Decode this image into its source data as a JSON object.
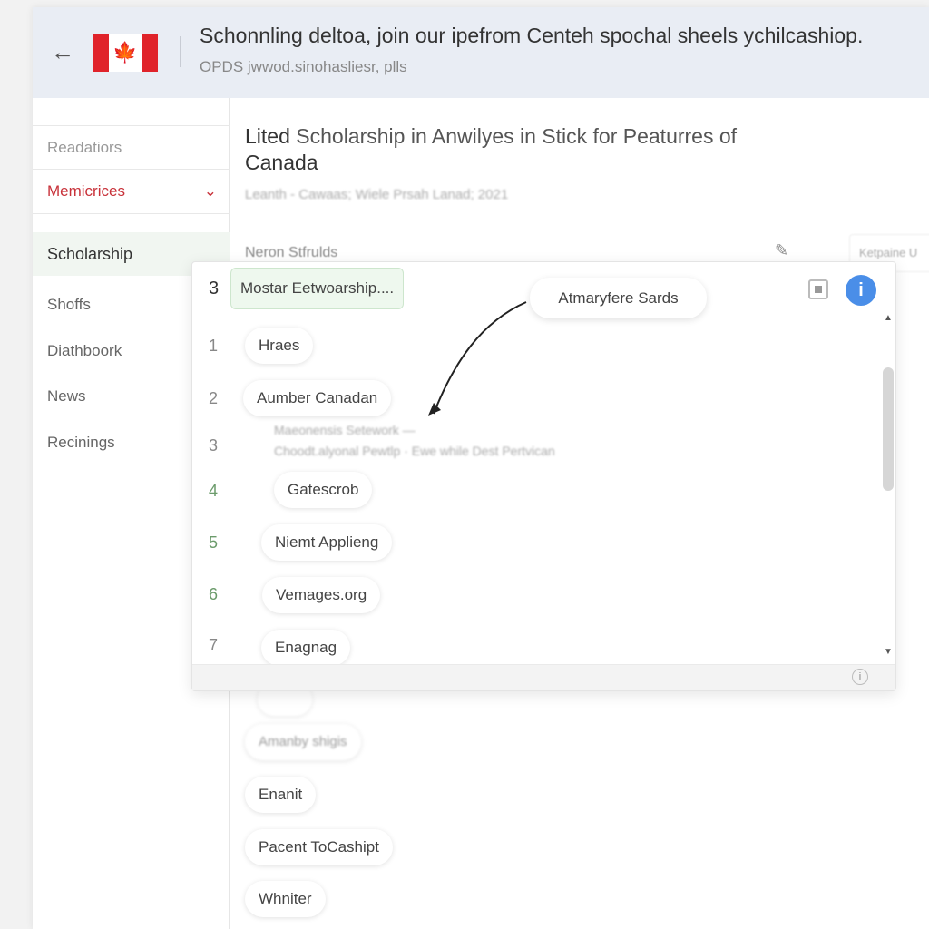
{
  "header": {
    "title": "Schonnling deltoa, join our ipefrom Centeh spochal sheels ychilcashiop.",
    "subtitle": "OPDS jwwod.sinohasliesr, plls",
    "flag": "canada-flag",
    "back_icon": "arrow-left"
  },
  "sidebar": {
    "items": [
      {
        "label": "Readatiors"
      },
      {
        "label": "Memicrices"
      },
      {
        "label": "Scholarship"
      },
      {
        "label": "Shoffs"
      },
      {
        "label": "Diathboork"
      },
      {
        "label": "News"
      },
      {
        "label": "Recinings"
      }
    ]
  },
  "main": {
    "title_a": "Lited ",
    "title_b": "Scholarship in Anwilyes in Stick for Peaturres of",
    "title_c": "Canada",
    "subtitle": "Leanth - Cawaas; Wiele Prsah Lanad; 2021",
    "section": "Neron Stfrulds",
    "input_placeholder": "Ketpaine U"
  },
  "popup": {
    "header_num": "3",
    "header_chip": "Mostar Eetwoarship....",
    "callout": "Atmaryfere Sards",
    "rows": [
      {
        "num": "1",
        "label": "Hraes"
      },
      {
        "num": "2",
        "label": "Aumber Canadan"
      },
      {
        "num": "3",
        "label": ""
      },
      {
        "num": "4",
        "label": "Gatescrob"
      },
      {
        "num": "5",
        "label": "Niemt Applieng"
      },
      {
        "num": "6",
        "label": "Vemages.org"
      },
      {
        "num": "7",
        "label": "Enagnag"
      }
    ],
    "blurred_1": "Maeonensis Setework —",
    "blurred_2": "Choodt.alyonal Pewtlp · Ewe while Dest Pertvican"
  },
  "below": {
    "items": [
      "Amanby shigis",
      "Enanit",
      "Pacent ToCashipt",
      "Whniter"
    ]
  },
  "colors": {
    "accent_red": "#c8323a",
    "info_blue": "#4a8ee8",
    "header_bg": "#e9edf4"
  }
}
